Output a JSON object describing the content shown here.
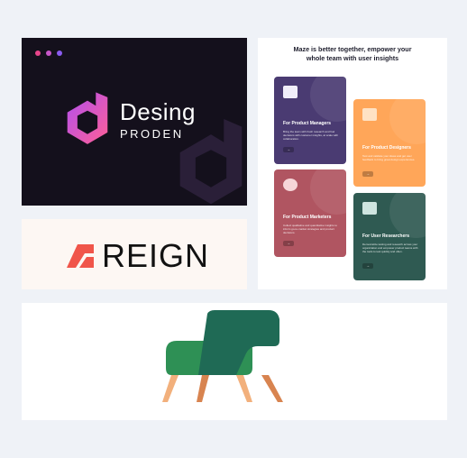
{
  "desing": {
    "wordmark": "Desing",
    "subline": "PRODEN",
    "dot_colors": [
      "#e8458b",
      "#c857c9",
      "#8a5cf0"
    ],
    "gradient": [
      "#b04ff0",
      "#ff5f96"
    ]
  },
  "reign": {
    "wordmark": "REIGN",
    "mark_color": "#f0554a"
  },
  "maze": {
    "title_line1": "Maze is better together, empower your",
    "title_line2": "whole team with user insights",
    "cards": [
      {
        "heading": "For Product Managers",
        "body": "Bring the team with fresh research and fuel decisions with customer insights, at scale with collaboration.",
        "button": "→",
        "color": "#4a3b72"
      },
      {
        "heading": "For Product Designers",
        "body": "Test and validate your ideas and get user feedback to bring great design experiences.",
        "button": "→",
        "color": "#ffa659"
      },
      {
        "heading": "For Product Marketers",
        "body": "Collect qualitative and quantitative insights to inform go-to-market strategies and product decisions.",
        "button": "→",
        "color": "#b05561"
      },
      {
        "heading": "For User Researchers",
        "body": "Democratize testing and research across your organization and empower product teams with the tools to test quickly and often.",
        "button": "→",
        "color": "#2f5a52"
      }
    ]
  },
  "chair": {
    "seat_color": "#2e9055",
    "back_color": "#1f6a55",
    "leg_light": "#f2b07c",
    "leg_dark": "#d88450"
  }
}
